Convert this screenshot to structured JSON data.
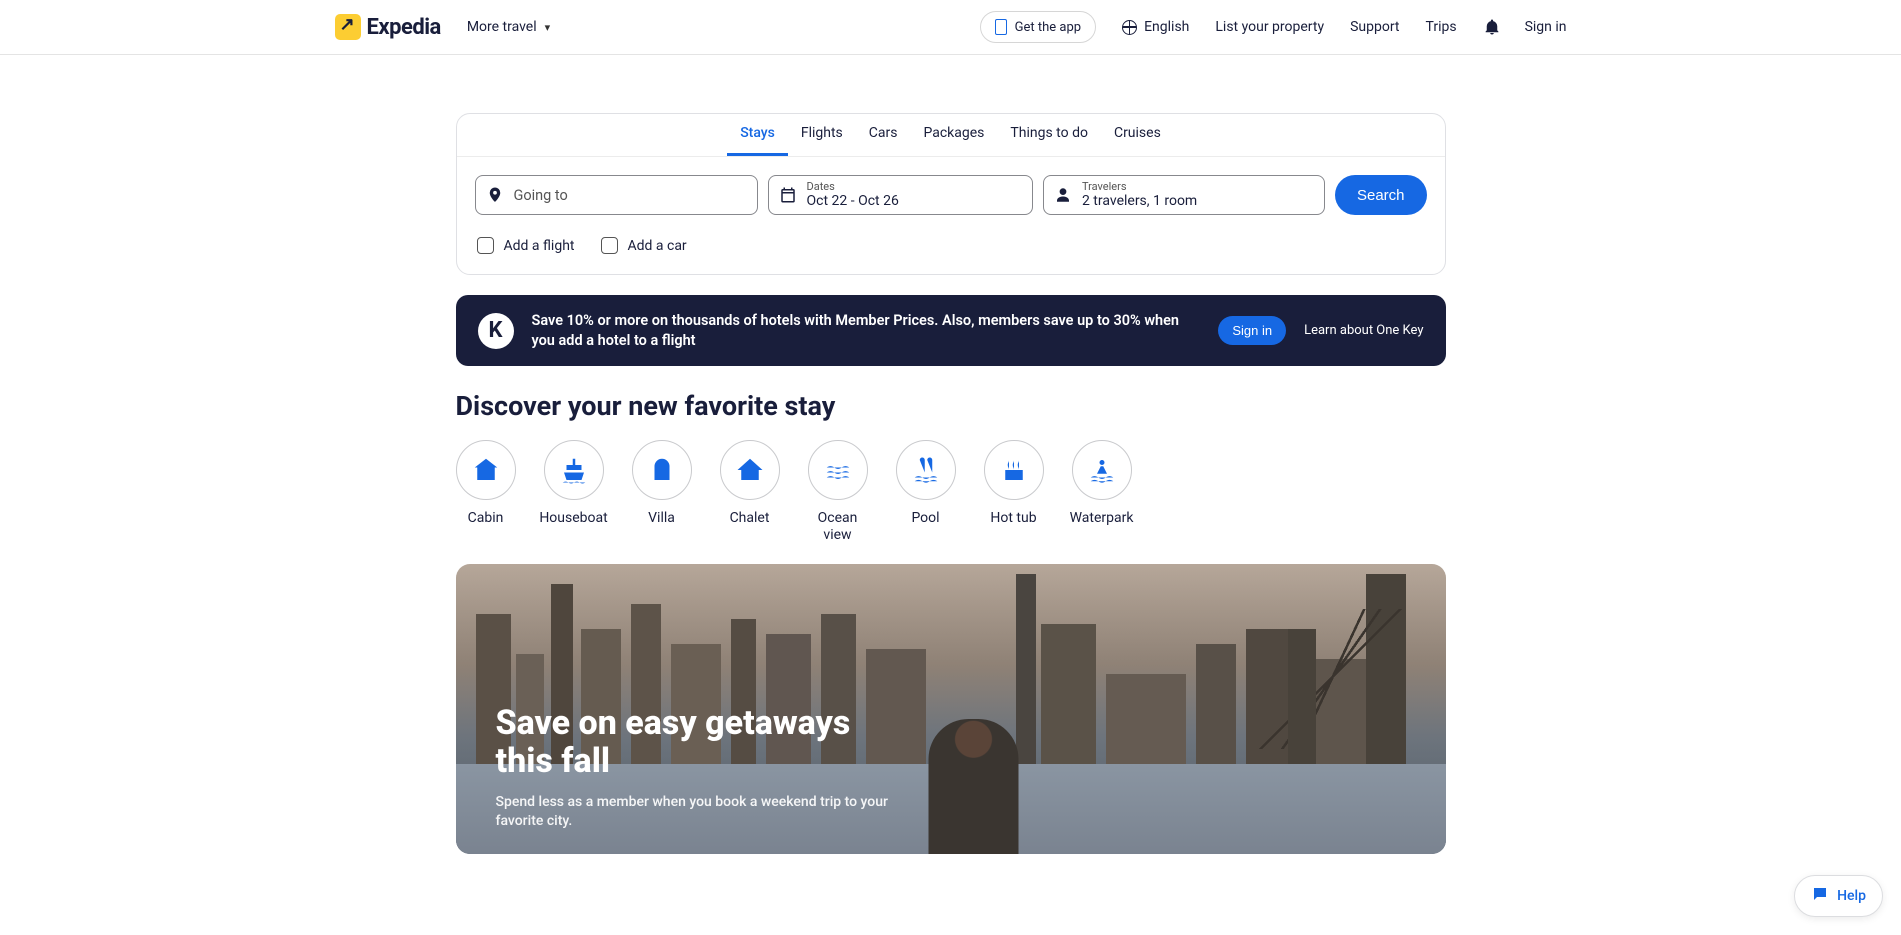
{
  "header": {
    "brand": "Expedia",
    "more_travel": "More travel",
    "get_app": "Get the app",
    "language": "English",
    "list_property": "List your property",
    "support": "Support",
    "trips": "Trips",
    "sign_in": "Sign in"
  },
  "search": {
    "tabs": [
      "Stays",
      "Flights",
      "Cars",
      "Packages",
      "Things to do",
      "Cruises"
    ],
    "active_tab_index": 0,
    "destination_placeholder": "Going to",
    "dates_label": "Dates",
    "dates_value": "Oct 22 - Oct 26",
    "travelers_label": "Travelers",
    "travelers_value": "2 travelers, 1 room",
    "search_btn": "Search",
    "addon_flight": "Add a flight",
    "addon_car": "Add a car"
  },
  "promo": {
    "text": "Save 10% or more on thousands of hotels with Member Prices. Also, members save up to 30% when you add a hotel to a flight",
    "sign_in": "Sign in",
    "learn": "Learn about One Key"
  },
  "discover": {
    "title": "Discover your new favorite stay",
    "categories": [
      {
        "key": "cabin",
        "label": "Cabin"
      },
      {
        "key": "houseboat",
        "label": "Houseboat"
      },
      {
        "key": "villa",
        "label": "Villa"
      },
      {
        "key": "chalet",
        "label": "Chalet"
      },
      {
        "key": "ocean-view",
        "label": "Ocean view"
      },
      {
        "key": "pool",
        "label": "Pool"
      },
      {
        "key": "hot-tub",
        "label": "Hot tub"
      },
      {
        "key": "waterpark",
        "label": "Waterpark"
      }
    ]
  },
  "hero": {
    "title": "Save on easy getaways this fall",
    "subtitle": "Spend less as a member when you book a weekend trip to your favorite city."
  },
  "help": {
    "label": "Help"
  }
}
